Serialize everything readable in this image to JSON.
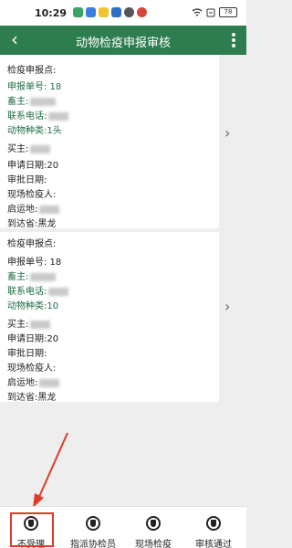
{
  "status_bar": {
    "time": "10:29",
    "battery": "78"
  },
  "header": {
    "title": "动物检疫申报审核"
  },
  "cards": [
    {
      "lines": [
        "检疫申报点:",
        "申报单号: 18",
        "畜主:",
        "联系电话:",
        "动物种类:1头",
        "买主:",
        "申请日期:20",
        "审批日期:",
        "现场检疫人:",
        "启运地:",
        "到达省:黑龙"
      ]
    },
    {
      "lines": [
        "检疫申报点:",
        "申报单号: 18",
        "畜主:",
        "联系电话:",
        "动物种类:10",
        "买主:",
        "申请日期:20",
        "审批日期:",
        "现场检疫人:",
        "启运地:",
        "到达省:黑龙"
      ]
    }
  ],
  "bottom_bar": {
    "buttons": [
      {
        "label": "不受理"
      },
      {
        "label": "指派协检员"
      },
      {
        "label": "现场检疫"
      },
      {
        "label": "审核通过"
      }
    ]
  },
  "colors": {
    "header_bg": "#2e7d4f",
    "highlight": "#e03a2a"
  }
}
